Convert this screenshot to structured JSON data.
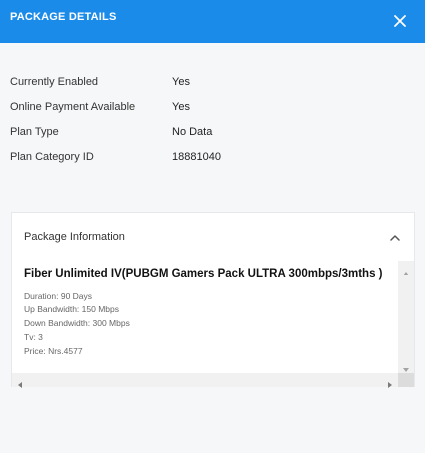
{
  "header": {
    "title": "PACKAGE DETAILS",
    "close_icon": "close-icon",
    "background_color": "#1a8be8"
  },
  "details": [
    {
      "label": "Currently Enabled",
      "value": "Yes"
    },
    {
      "label": "Online Payment Available",
      "value": "Yes"
    },
    {
      "label": "Plan Type",
      "value": "No Data"
    },
    {
      "label": "Plan Category ID",
      "value": "18881040"
    }
  ],
  "panel": {
    "title": "Package Information",
    "toggle_icon": "chevron-up-icon",
    "package_name": "Fiber Unlimited IV(PUBGM Gamers Pack ULTRA 300mbps/3mths )",
    "lines": [
      "Duration: 90 Days",
      "Up Bandwidth: 150 Mbps",
      "Down Bandwidth: 300 Mbps",
      "Tv: 3",
      "Price: Nrs.4577"
    ]
  }
}
